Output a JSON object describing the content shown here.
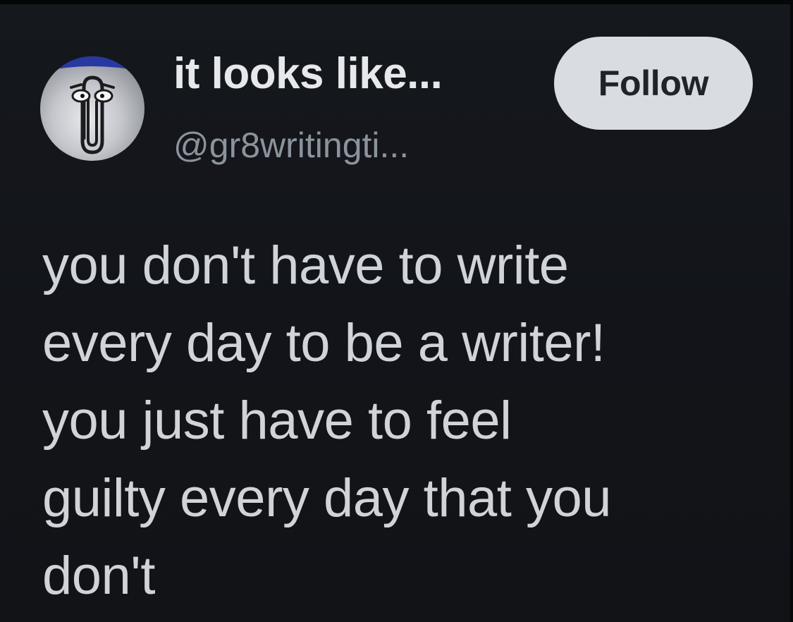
{
  "author": {
    "display_name": "it looks like...",
    "handle": "@gr8writingti...",
    "avatar_icon": "paperclip-assistant-icon"
  },
  "follow_button": {
    "label": "Follow"
  },
  "post": {
    "lines": [
      "you don't have to write",
      "every day to be a writer!",
      "you just have to feel",
      "guilty every day that you",
      "don't"
    ]
  },
  "colors": {
    "background": "#111317",
    "text": "#d0d4d8",
    "handle": "#8b939c",
    "follow_button_bg": "#d9dde1",
    "follow_button_text": "#202327"
  }
}
